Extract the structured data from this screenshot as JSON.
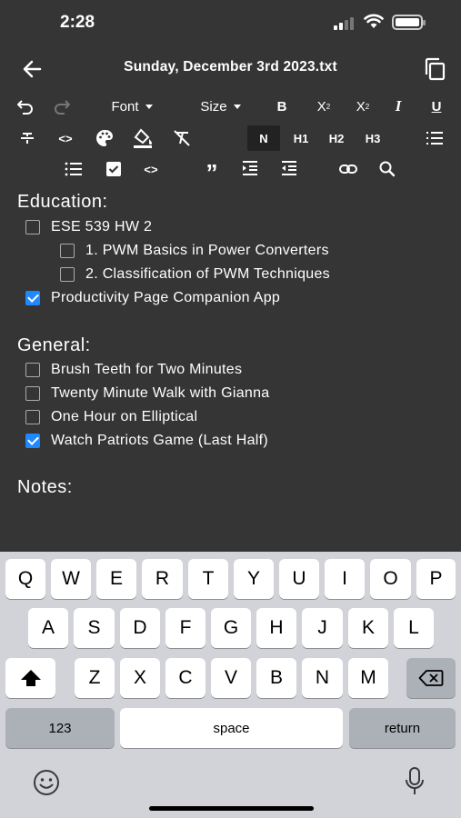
{
  "status": {
    "time": "2:28"
  },
  "header": {
    "title": "Sunday, December 3rd 2023.txt"
  },
  "toolbar": {
    "font_label": "Font",
    "size_label": "Size",
    "bold": "B",
    "subscript": "X",
    "subscript_mark": "2",
    "superscript": "X",
    "superscript_mark": "2",
    "italic": "I",
    "underline": "U",
    "normal": "N",
    "h1": "H1",
    "h2": "H2",
    "h3": "H3",
    "code1": "<>",
    "code2": "<>",
    "quote": "”"
  },
  "content": {
    "sections": [
      {
        "title": "Education:",
        "items": [
          {
            "label": "ESE 539 HW 2",
            "checked": false
          },
          {
            "label": "1. PWM Basics in Power Converters",
            "checked": false
          },
          {
            "label": "2. Classification of PWM Techniques",
            "checked": false
          },
          {
            "label": "Productivity Page Companion App",
            "checked": true
          }
        ]
      },
      {
        "title": "General:",
        "items": [
          {
            "label": "Brush Teeth for Two Minutes",
            "checked": false
          },
          {
            "label": "Twenty Minute Walk with Gianna",
            "checked": false
          },
          {
            "label": "One Hour on Elliptical",
            "checked": false
          },
          {
            "label": "Watch Patriots Game (Last Half)",
            "checked": true
          }
        ]
      },
      {
        "title": "Notes:"
      }
    ]
  },
  "keyboard": {
    "row1": [
      "Q",
      "W",
      "E",
      "R",
      "T",
      "Y",
      "U",
      "I",
      "O",
      "P"
    ],
    "row2": [
      "A",
      "S",
      "D",
      "F",
      "G",
      "H",
      "J",
      "K",
      "L"
    ],
    "row3": [
      "Z",
      "X",
      "C",
      "V",
      "B",
      "N",
      "M"
    ],
    "numbers_label": "123",
    "space_label": "space",
    "return_label": "return"
  },
  "colors": {
    "background": "#353535",
    "checkbox_checked": "#1e88ff",
    "keyboard_bg": "#d1d3d9"
  },
  "icons": [
    "undo-icon",
    "redo-icon",
    "strikethrough-icon",
    "code-icon",
    "palette-icon",
    "highlight-icon",
    "clear-format-icon",
    "list-icon",
    "bullet-list-icon",
    "checkbox-icon",
    "quote-icon",
    "indent-icon",
    "outdent-icon",
    "link-icon",
    "search-icon",
    "back-arrow-icon",
    "copy-icon",
    "emoji-icon",
    "microphone-icon",
    "shift-icon",
    "backspace-icon"
  ]
}
